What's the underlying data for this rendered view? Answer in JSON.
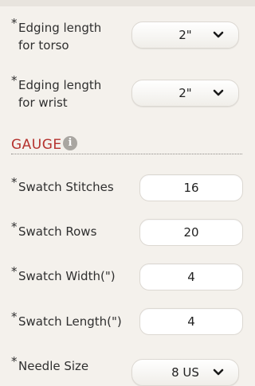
{
  "edging": {
    "torso_label_line1": "Edging length",
    "torso_label_line2": "for torso",
    "torso_value": "2\"",
    "wrist_label_line1": "Edging length",
    "wrist_label_line2": "for wrist",
    "wrist_value": "2\""
  },
  "gauge": {
    "section_title": "GAUGE",
    "info_glyph": "i",
    "fields": [
      {
        "label": "Swatch Stitches",
        "value": "16"
      },
      {
        "label": "Swatch Rows",
        "value": "20"
      },
      {
        "label": "Swatch Width(\")",
        "value": "4"
      },
      {
        "label": "Swatch Length(\")",
        "value": "4"
      }
    ],
    "needle_label": "Needle Size",
    "needle_value": "8 US"
  },
  "required_marker": "*",
  "colors": {
    "section_title": "#b5322e",
    "background": "#f4f1ec"
  },
  "icons": {
    "dropdown": "chevron-down-icon",
    "info": "info-icon"
  }
}
